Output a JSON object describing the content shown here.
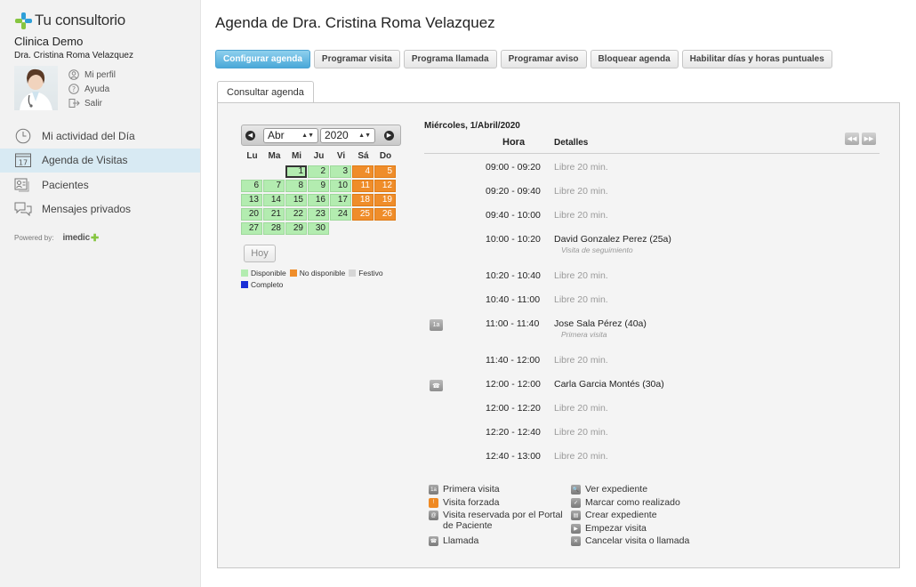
{
  "sidebar": {
    "logo_text": "Tu consultorio",
    "clinic": "Clinica Demo",
    "doctor": "Dra. Cristina Roma Velazquez",
    "user_menu": [
      {
        "label": "Mi perfil",
        "icon": "user-icon"
      },
      {
        "label": "Ayuda",
        "icon": "help-icon"
      },
      {
        "label": "Salir",
        "icon": "logout-icon"
      }
    ],
    "nav": [
      {
        "label": "Mi actividad del Día",
        "icon": "clock-icon",
        "active": false
      },
      {
        "label": "Agenda de Visitas",
        "icon": "calendar-icon",
        "active": true,
        "icon_text": "17"
      },
      {
        "label": "Pacientes",
        "icon": "patients-icon",
        "active": false
      },
      {
        "label": "Mensajes privados",
        "icon": "messages-icon",
        "active": false
      }
    ],
    "powered_by": "Powered by:",
    "powered_brand": "imedic",
    "powered_plus": "✚"
  },
  "main": {
    "title": "Agenda de Dra. Cristina Roma Velazquez",
    "toolbar": [
      "Configurar agenda",
      "Programar visita",
      "Programa llamada",
      "Programar aviso",
      "Bloquear agenda",
      "Habilitar días y horas puntuales"
    ],
    "tab": "Consultar agenda"
  },
  "calendar": {
    "month": "Abr",
    "year": "2020",
    "weekdays": [
      "Lu",
      "Ma",
      "Mi",
      "Ju",
      "Vi",
      "Sá",
      "Do"
    ],
    "weeks": [
      [
        null,
        null,
        {
          "d": "1",
          "s": "today"
        },
        {
          "d": "2",
          "s": "avail"
        },
        {
          "d": "3",
          "s": "avail"
        },
        {
          "d": "4",
          "s": "unav"
        },
        {
          "d": "5",
          "s": "unav"
        }
      ],
      [
        {
          "d": "6",
          "s": "avail"
        },
        {
          "d": "7",
          "s": "avail"
        },
        {
          "d": "8",
          "s": "avail"
        },
        {
          "d": "9",
          "s": "avail"
        },
        {
          "d": "10",
          "s": "avail"
        },
        {
          "d": "11",
          "s": "unav"
        },
        {
          "d": "12",
          "s": "unav"
        }
      ],
      [
        {
          "d": "13",
          "s": "avail"
        },
        {
          "d": "14",
          "s": "avail"
        },
        {
          "d": "15",
          "s": "avail"
        },
        {
          "d": "16",
          "s": "avail"
        },
        {
          "d": "17",
          "s": "avail"
        },
        {
          "d": "18",
          "s": "unav"
        },
        {
          "d": "19",
          "s": "unav"
        }
      ],
      [
        {
          "d": "20",
          "s": "avail"
        },
        {
          "d": "21",
          "s": "avail"
        },
        {
          "d": "22",
          "s": "avail"
        },
        {
          "d": "23",
          "s": "avail"
        },
        {
          "d": "24",
          "s": "avail"
        },
        {
          "d": "25",
          "s": "unav"
        },
        {
          "d": "26",
          "s": "unav"
        }
      ],
      [
        {
          "d": "27",
          "s": "avail"
        },
        {
          "d": "28",
          "s": "avail"
        },
        {
          "d": "29",
          "s": "avail"
        },
        {
          "d": "30",
          "s": "avail"
        },
        null,
        null,
        null
      ]
    ],
    "today_button": "Hoy",
    "legend": [
      {
        "label": "Disponible",
        "color": "#b3ecb0"
      },
      {
        "label": "No disponible",
        "color": "#ef8d2a"
      },
      {
        "label": "Festivo",
        "color": "#d6d6d6"
      },
      {
        "label": "Completo",
        "color": "#1a2fd6"
      }
    ]
  },
  "agenda": {
    "date": "Miércoles, 1/Abril/2020",
    "col_hora": "Hora",
    "col_detalles": "Detalles",
    "slots": [
      {
        "time": "09:00 - 09:20",
        "detail": "Libre 20 min.",
        "free": true
      },
      {
        "time": "09:20 - 09:40",
        "detail": "Libre 20 min.",
        "free": true
      },
      {
        "time": "09:40 - 10:00",
        "detail": "Libre 20 min.",
        "free": true
      },
      {
        "time": "10:00 - 10:20",
        "detail": "David Gonzalez Perez (25a)",
        "sub": "Visita de seguimiento",
        "free": false
      },
      {
        "time": "10:20 - 10:40",
        "detail": "Libre 20 min.",
        "free": true
      },
      {
        "time": "10:40 - 11:00",
        "detail": "Libre 20 min.",
        "free": true
      },
      {
        "time": "11:00 - 11:40",
        "detail": "Jose Sala Pérez (40a)",
        "sub": "Primera visita",
        "badge": "1a",
        "free": false
      },
      {
        "time": "11:40 - 12:00",
        "detail": "Libre 20 min.",
        "free": true
      },
      {
        "time": "12:00 - 12:00",
        "detail": "Carla Garcia Montés (30a)",
        "badge": "☎",
        "free": false
      },
      {
        "time": "12:00 - 12:20",
        "detail": "Libre 20 min.",
        "free": true
      },
      {
        "time": "12:20 - 12:40",
        "detail": "Libre 20 min.",
        "free": true
      },
      {
        "time": "12:40 - 13:00",
        "detail": "Libre 20 min.",
        "free": true
      }
    ]
  },
  "icon_legend": {
    "left": [
      {
        "label": "Primera visita",
        "icon": "first-visit-icon",
        "glyph": "1a"
      },
      {
        "label": "Visita forzada",
        "icon": "forced-visit-icon",
        "glyph": "!"
      },
      {
        "label": "Visita reservada por el Portal de Paciente",
        "icon": "portal-icon",
        "glyph": "@"
      },
      {
        "label": "Llamada",
        "icon": "phone-icon",
        "glyph": "☎"
      }
    ],
    "right": [
      {
        "label": "Ver expediente",
        "icon": "view-record-icon",
        "glyph": "🔍"
      },
      {
        "label": "Marcar como realizado",
        "icon": "check-icon",
        "glyph": "✓"
      },
      {
        "label": "Crear expediente",
        "icon": "create-record-icon",
        "glyph": "▤"
      },
      {
        "label": "Empezar visita",
        "icon": "start-visit-icon",
        "glyph": "▶"
      },
      {
        "label": "Cancelar visita o llamada",
        "icon": "cancel-icon",
        "glyph": "✕"
      }
    ]
  }
}
